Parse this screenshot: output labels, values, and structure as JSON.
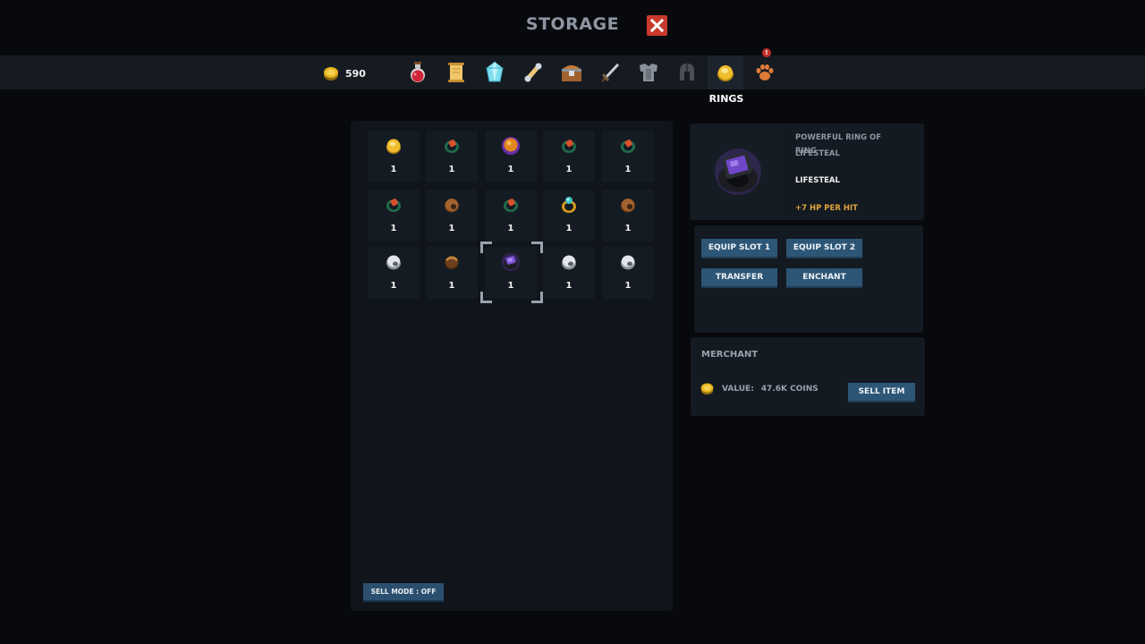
{
  "header": {
    "title": "STORAGE"
  },
  "topbar": {
    "coins": "590",
    "tabs": [
      {
        "icon": "potion-icon"
      },
      {
        "icon": "scroll-icon"
      },
      {
        "icon": "crystal-icon"
      },
      {
        "icon": "bone-icon"
      },
      {
        "icon": "chest-icon"
      },
      {
        "icon": "sword-icon"
      },
      {
        "icon": "armor-icon"
      },
      {
        "icon": "helmet-icon"
      },
      {
        "icon": "ring-icon"
      },
      {
        "icon": "paw-icon"
      }
    ],
    "active_tab_label": "RINGS",
    "alert_badge": "!"
  },
  "inventory": {
    "rows": [
      [
        {
          "ring": "gold-ring-icon",
          "qty": "1"
        },
        {
          "ring": "emerald-ring-icon",
          "qty": "1"
        },
        {
          "ring": "amber-orb-ring-icon",
          "qty": "1"
        },
        {
          "ring": "emerald-ring-icon",
          "qty": "1"
        },
        {
          "ring": "emerald-ring-icon",
          "qty": "1"
        }
      ],
      [
        {
          "ring": "emerald-ring-icon",
          "qty": "1"
        },
        {
          "ring": "bronze-ring-icon",
          "qty": "1"
        },
        {
          "ring": "emerald-ring-icon",
          "qty": "1"
        },
        {
          "ring": "sapphire-gold-ring-icon",
          "qty": "1"
        },
        {
          "ring": "bronze-ring-icon",
          "qty": "1"
        }
      ],
      [
        {
          "ring": "silver-ring-icon",
          "qty": "1"
        },
        {
          "ring": "dark-bronze-ring-icon",
          "qty": "1"
        },
        {
          "ring": "lifesteal-ring-icon",
          "qty": "1"
        },
        {
          "ring": "silver-ring-icon",
          "qty": "1"
        },
        {
          "ring": "silver-ring-icon",
          "qty": "1"
        }
      ]
    ],
    "selected": {
      "row": 2,
      "col": 2
    },
    "sell_mode_label": "SELL MODE : OFF"
  },
  "detail": {
    "name": "POWERFUL RING OF LIFESTEAL",
    "type": "RING",
    "stat_name": "LIFESTEAL",
    "stat_value": "+7 HP PER HIT"
  },
  "actions": {
    "equip_slot_1": "EQUIP SLOT 1",
    "equip_slot_2": "EQUIP SLOT 2",
    "transfer": "TRANSFER",
    "enchant": "ENCHANT"
  },
  "merchant": {
    "title": "MERCHANT",
    "value_label": "VALUE:",
    "value_amount": "47.6K COINS",
    "sell_label": "SELL ITEM"
  },
  "colors": {
    "accent_button": "#2d5676",
    "close_red": "#c73a2c",
    "stat_orange": "#e0a43a"
  }
}
